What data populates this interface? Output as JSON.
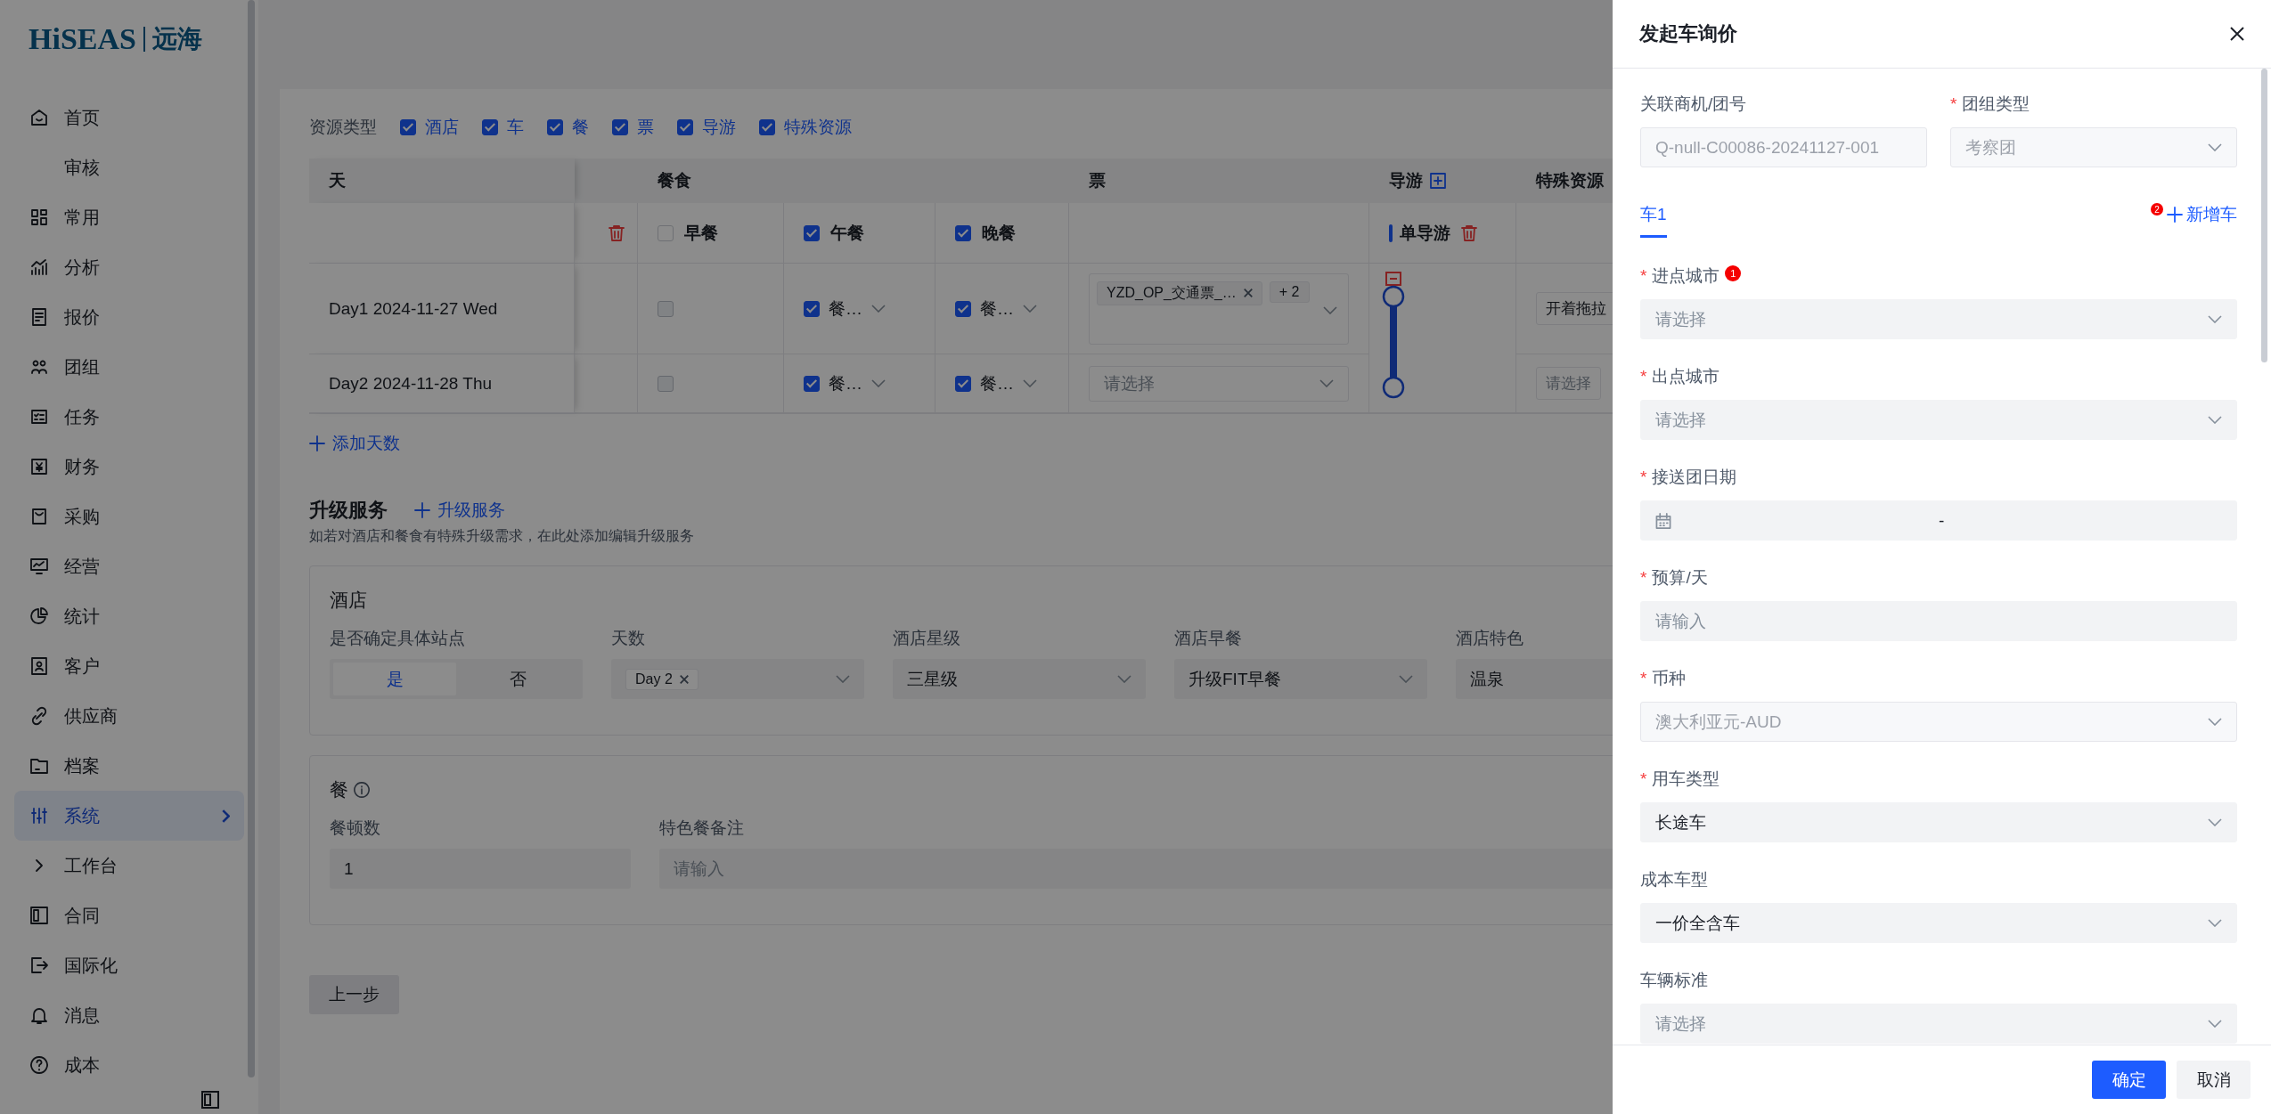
{
  "logo": {
    "brand": "HiSEAS",
    "name": "远海"
  },
  "sidebar": {
    "items": [
      {
        "label": "首页",
        "selected": false
      },
      {
        "label": "审核",
        "selected": false
      },
      {
        "label": "常用",
        "selected": false
      },
      {
        "label": "分析",
        "selected": false
      },
      {
        "label": "报价",
        "selected": false
      },
      {
        "label": "团组",
        "selected": false
      },
      {
        "label": "任务",
        "selected": false
      },
      {
        "label": "财务",
        "selected": false
      },
      {
        "label": "采购",
        "selected": false
      },
      {
        "label": "经营",
        "selected": false
      },
      {
        "label": "统计",
        "selected": false
      },
      {
        "label": "客户",
        "selected": false
      },
      {
        "label": "供应商",
        "selected": false
      },
      {
        "label": "档案",
        "selected": false
      },
      {
        "label": "系统",
        "selected": true
      },
      {
        "label": "工作台",
        "selected": false
      },
      {
        "label": "合同",
        "selected": false
      },
      {
        "label": "国际化",
        "selected": false
      },
      {
        "label": "消息",
        "selected": false
      },
      {
        "label": "成本",
        "selected": false
      }
    ]
  },
  "resource_types": {
    "label": "资源类型",
    "options": [
      {
        "label": "酒店",
        "checked": true
      },
      {
        "label": "车",
        "checked": true
      },
      {
        "label": "餐",
        "checked": true
      },
      {
        "label": "票",
        "checked": true
      },
      {
        "label": "导游",
        "checked": true
      },
      {
        "label": "特殊资源",
        "checked": true
      }
    ]
  },
  "table": {
    "columns": [
      {
        "label": "天"
      },
      {
        "label": "餐食"
      },
      {
        "label": "票"
      },
      {
        "label": "导游"
      },
      {
        "label": "特殊资源"
      }
    ],
    "meal_headers": [
      {
        "label": "早餐",
        "checked": false
      },
      {
        "label": "午餐",
        "checked": true
      },
      {
        "label": "晚餐",
        "checked": true
      }
    ],
    "guide_header": "单导游",
    "rows": [
      {
        "day": "Day1 2024-11-27 Wed",
        "meals": [
          {
            "checked": false
          },
          {
            "checked": true,
            "value": "餐…"
          },
          {
            "checked": true,
            "value": "餐…"
          }
        ],
        "ticket": {
          "tags": [
            "YZD_OP_交通票_…"
          ],
          "more": "+ 2"
        },
        "special": {
          "value": "开着拖拉"
        }
      },
      {
        "day": "Day2 2024-11-28 Thu",
        "meals": [
          {
            "checked": false
          },
          {
            "checked": true,
            "value": "餐…"
          },
          {
            "checked": true,
            "value": "餐…"
          }
        ],
        "ticket": {
          "placeholder": "请选择"
        },
        "special": {
          "placeholder": "请选择"
        }
      }
    ]
  },
  "add_day": "添加天数",
  "upgrade": {
    "title": "升级服务",
    "add": "升级服务",
    "hint": "如若对酒店和餐食有特殊升级需求，在此处添加编辑升级服务",
    "hotel": {
      "title": "酒店",
      "fields": [
        {
          "kind": "segmented",
          "label": "是否确定具体站点",
          "options": [
            {
              "label": "是",
              "selected": true
            },
            {
              "label": "否",
              "selected": false
            }
          ]
        },
        {
          "kind": "tags",
          "label": "天数",
          "tags": [
            "Day 2"
          ]
        },
        {
          "kind": "select",
          "label": "酒店星级",
          "value": "三星级"
        },
        {
          "kind": "select",
          "label": "酒店早餐",
          "value": "升级FIT早餐"
        },
        {
          "kind": "text",
          "label": "酒店特色",
          "value": "温泉"
        }
      ]
    },
    "meal": {
      "title": "餐",
      "fields": [
        {
          "kind": "text",
          "label": "餐顿数",
          "value": "1"
        },
        {
          "kind": "text",
          "label": "特色餐备注",
          "placeholder": "请输入"
        }
      ]
    }
  },
  "back_button": "上一步",
  "drawer": {
    "title": "发起车询价",
    "required_mark": "*",
    "top_fields": [
      {
        "kind": "input",
        "label": "关联商机/团号",
        "required": false,
        "disabled": true,
        "value": "Q-null-C00086-20241127-001"
      },
      {
        "kind": "select",
        "label": "团组类型",
        "required": true,
        "disabled": true,
        "value": "考察团"
      }
    ],
    "tabs": [
      {
        "label": "车1",
        "selected": true
      }
    ],
    "add_car": {
      "label": "新增车",
      "badge": "2"
    },
    "fields": [
      {
        "kind": "select",
        "label": "进点城市",
        "required": true,
        "disabled": false,
        "badge": "1",
        "placeholder": "请选择"
      },
      {
        "kind": "select",
        "label": "出点城市",
        "required": true,
        "disabled": false,
        "placeholder": "请选择"
      },
      {
        "kind": "date_range",
        "label": "接送团日期",
        "required": true,
        "disabled": false,
        "separator": "-"
      },
      {
        "kind": "input",
        "label": "预算/天",
        "required": true,
        "disabled": false,
        "placeholder": "请输入"
      },
      {
        "kind": "select",
        "label": "币种",
        "required": true,
        "disabled": true,
        "value": "澳大利亚元-AUD"
      },
      {
        "kind": "select",
        "label": "用车类型",
        "required": true,
        "disabled": false,
        "value": "长途车"
      },
      {
        "kind": "select",
        "label": "成本车型",
        "required": false,
        "disabled": false,
        "value": "一价全含车"
      },
      {
        "kind": "select",
        "label": "车辆标准",
        "required": false,
        "disabled": false,
        "placeholder": "请选择"
      }
    ],
    "buttons": [
      {
        "label": "确定",
        "kind": "primary"
      },
      {
        "label": "取消",
        "kind": "default"
      }
    ]
  }
}
